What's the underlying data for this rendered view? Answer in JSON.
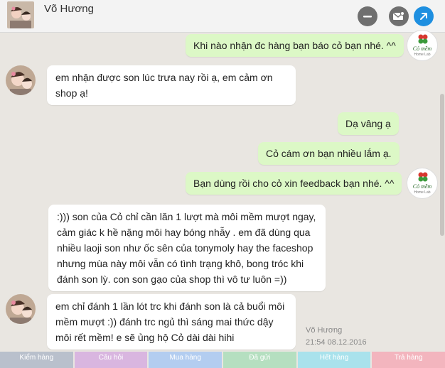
{
  "header": {
    "title": "Võ Hương"
  },
  "icons": {
    "minimize": "minus-circle-icon",
    "mail": "mail-icon",
    "open": "arrow-up-right-icon"
  },
  "brand": {
    "name": "Cỏ mềm",
    "tagline": "Home Lab"
  },
  "messages": [
    {
      "dir": "out",
      "text": "Khi nào nhận đc hàng bạn báo cỏ bạn nhé. ^^"
    },
    {
      "dir": "in",
      "text": "em nhận được son lúc trưa nay rồi ạ, em cảm ơn shop ạ!"
    },
    {
      "dir": "out",
      "text": "Dạ vâng ạ"
    },
    {
      "dir": "out",
      "text": "Cỏ cám ơn bạn nhiều lắm ạ."
    },
    {
      "dir": "out",
      "text": "Bạn dùng rồi cho cỏ xin feedback bạn nhé. ^^"
    },
    {
      "dir": "in",
      "text": ":))) son của Cỏ chỉ cần lăn 1 lượt mà môi mềm mượt ngay, cảm giác k hề nặng môi hay bóng nhẫy . em đã dùng qua nhiều laoji son như ốc sên của tonymoly hay the faceshop nhưng mùa này môi vẫn có tình trạng khô, bong tróc khi đánh son lỳ. con son gạo của shop thì vô tư luôn =))"
    },
    {
      "dir": "in",
      "text": "em chỉ đánh 1 lần lót trc khi đánh son là cả buổi môi mềm mượt :)) đánh trc ngủ thì sáng mai thức dậy môi rết mềm! e sẽ ủng hộ Cỏ dài dài hihi"
    }
  ],
  "last_meta": {
    "name": "Võ Hương",
    "time": "21:54 08.12.2016"
  },
  "tabs": [
    {
      "label": "Kiểm hàng",
      "color": "#b9c0cc"
    },
    {
      "label": "Câu hỏi",
      "color": "#d9b6e0"
    },
    {
      "label": "Mua hàng",
      "color": "#b3cdf0"
    },
    {
      "label": "Đã gửi",
      "color": "#b5dfc0"
    },
    {
      "label": "Hết hàng",
      "color": "#a9e2ec"
    },
    {
      "label": "Trả hàng",
      "color": "#f3b5be"
    }
  ]
}
